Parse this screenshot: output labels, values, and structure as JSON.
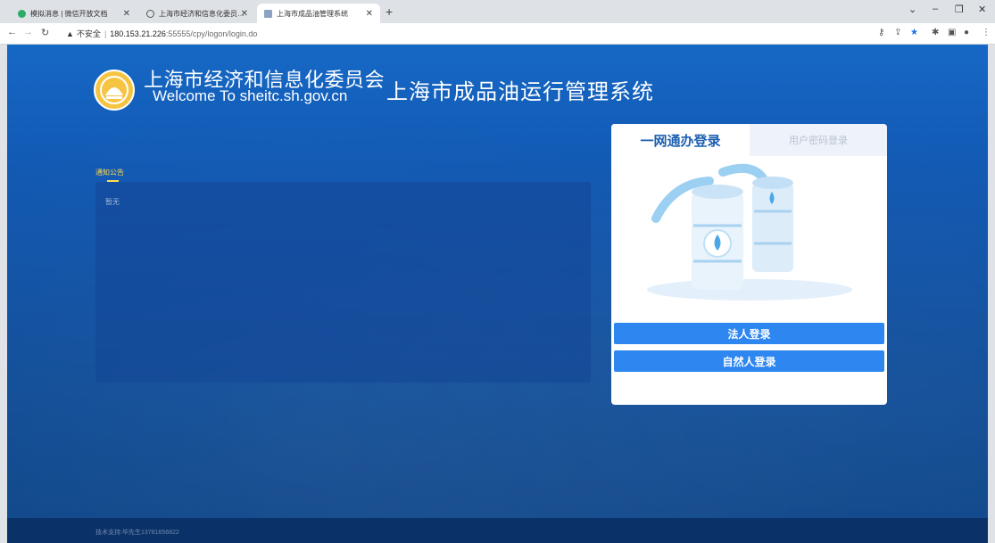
{
  "browser": {
    "tabs": [
      {
        "title": "模拟消息 | 微信开放文档",
        "active": false
      },
      {
        "title": "上海市经济和信息化委员会-行业",
        "active": false
      },
      {
        "title": "上海市成品油管理系统",
        "active": true
      }
    ],
    "new_tab_label": "+",
    "url": {
      "security_label": "不安全",
      "host": "180.153.21.226",
      "path": ":55555/cpy/logon/login.do"
    }
  },
  "header": {
    "org_name_cn": "上海市经济和信息化委员会",
    "org_name_en": "Welcome To sheitc.sh.gov.cn",
    "system_title": "上海市成品油运行管理系统"
  },
  "notice": {
    "title": "通知公告",
    "empty_text": "暂无"
  },
  "login": {
    "tabs": [
      {
        "label": "一网通办登录",
        "active": true
      },
      {
        "label": "用户密码登录",
        "active": false
      }
    ],
    "buttons": {
      "legal_person": "法人登录",
      "natural_person": "自然人登录"
    }
  },
  "footer": {
    "text": "技术支持:毕先生13781656822"
  },
  "colors": {
    "primary_button": "#2e86f0",
    "active_tab_text": "#1b5fb0",
    "notice_accent": "#ffdd55",
    "background": "#1259b3"
  }
}
